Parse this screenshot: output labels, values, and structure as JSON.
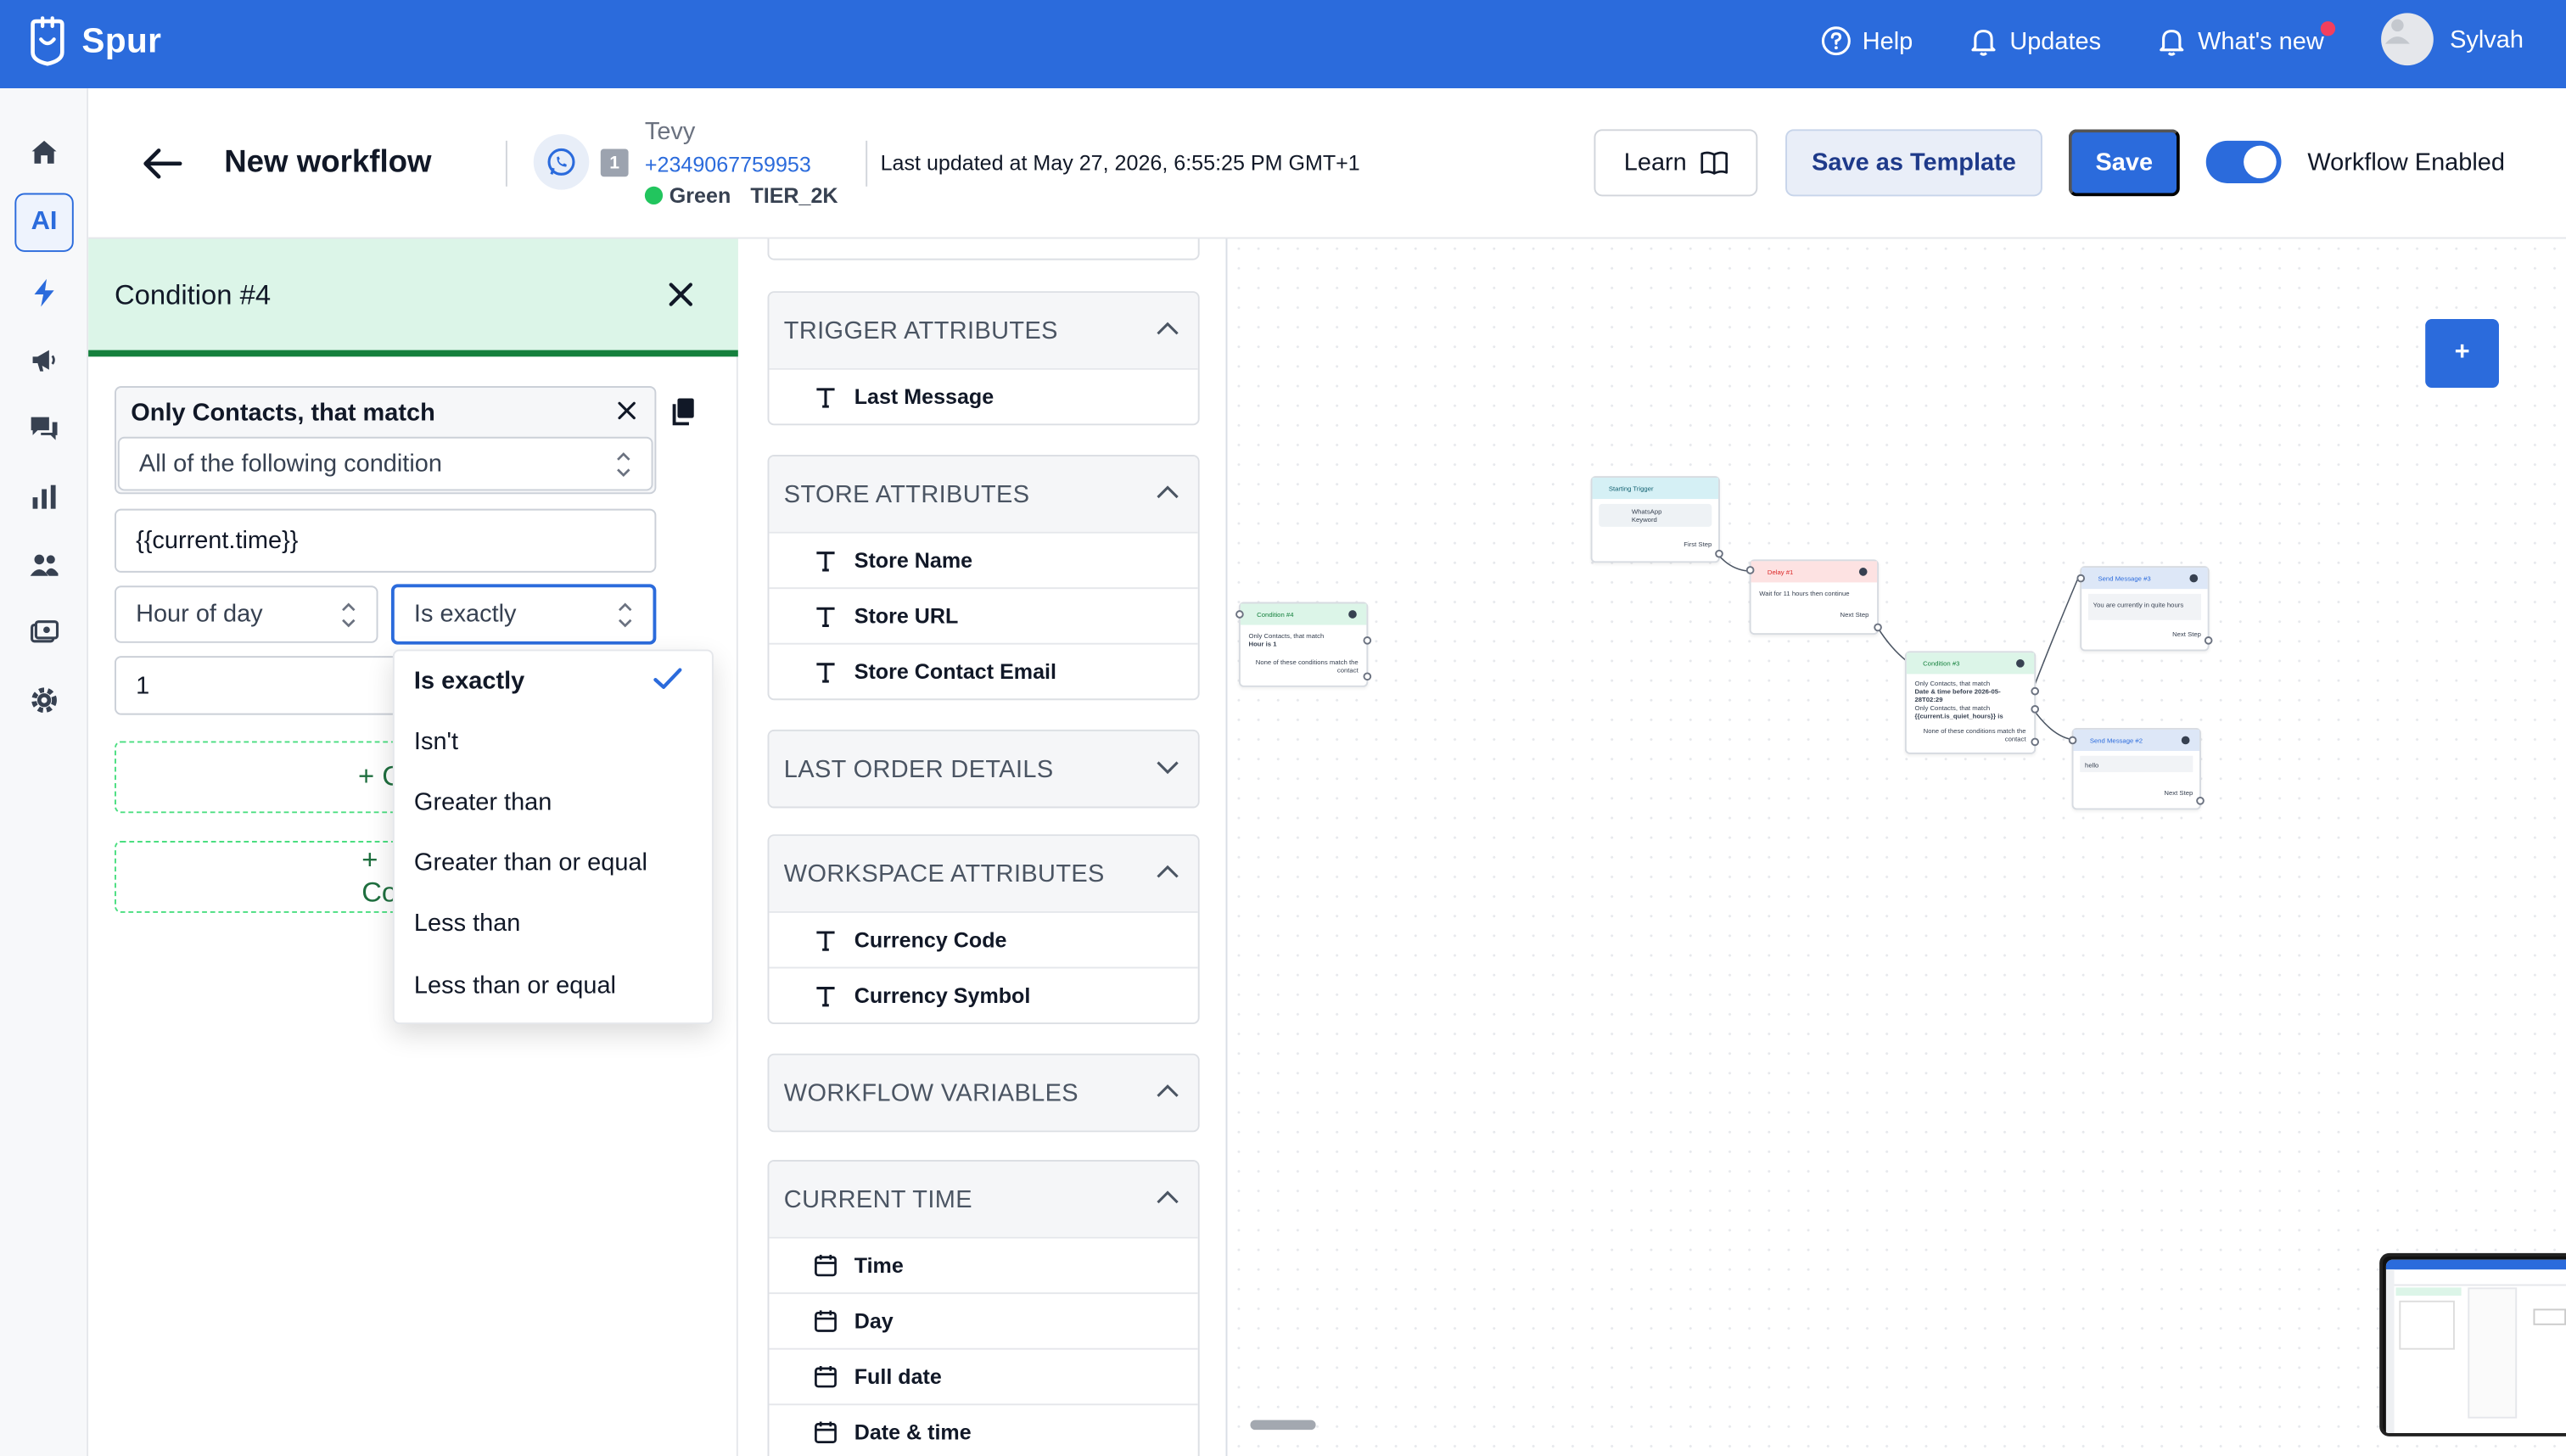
{
  "app": {
    "brand": "Spur"
  },
  "topbar": {
    "help": "Help",
    "updates": "Updates",
    "whats_new": "What's new",
    "user": "Sylvah"
  },
  "nav": {
    "ai_label": "AI"
  },
  "header": {
    "title": "New workflow",
    "account_number": "1",
    "account_name": "Tevy",
    "account_phone": "+2349067759953",
    "account_quality": "Green",
    "account_tier": "TIER_2K",
    "last_updated": "Last updated at May 27, 2026, 6:55:25 PM GMT+1",
    "learn": "Learn",
    "save_template": "Save as Template",
    "save": "Save",
    "workflow_enabled": "Workflow Enabled"
  },
  "condition": {
    "title": "Condition #4",
    "match_label": "Only Contacts, that match",
    "match_mode": "All of the following condition",
    "variable": "{{current.time}}",
    "field": "Hour of day",
    "operator": "Is exactly",
    "value": "1",
    "add_condition_1": "+ Co",
    "add_condition_2": "+ Condi",
    "operator_options": [
      "Is exactly",
      "Isn't",
      "Greater than",
      "Greater than or equal",
      "Less than",
      "Less than or equal"
    ]
  },
  "attributes": {
    "groups": [
      {
        "title": "TRIGGER ATTRIBUTES",
        "expanded": true,
        "items": [
          {
            "label": "Last Message",
            "icon": "text-icon"
          }
        ]
      },
      {
        "title": "STORE ATTRIBUTES",
        "expanded": true,
        "items": [
          {
            "label": "Store Name",
            "icon": "text-icon"
          },
          {
            "label": "Store URL",
            "icon": "text-icon"
          },
          {
            "label": "Store Contact Email",
            "icon": "text-icon"
          }
        ]
      },
      {
        "title": "LAST ORDER DETAILS",
        "expanded": false,
        "items": []
      },
      {
        "title": "WORKSPACE ATTRIBUTES",
        "expanded": true,
        "items": [
          {
            "label": "Currency Code",
            "icon": "text-icon"
          },
          {
            "label": "Currency Symbol",
            "icon": "text-icon"
          }
        ]
      },
      {
        "title": "WORKFLOW VARIABLES",
        "expanded": true,
        "items": []
      },
      {
        "title": "CURRENT TIME",
        "expanded": true,
        "items": [
          {
            "label": "Time",
            "icon": "calendar-icon"
          },
          {
            "label": "Day",
            "icon": "calendar-icon"
          },
          {
            "label": "Full date",
            "icon": "calendar-icon"
          },
          {
            "label": "Date & time",
            "icon": "calendar-icon"
          }
        ]
      }
    ]
  },
  "canvas": {
    "add_label": "+",
    "nodes": {
      "condition4": {
        "title": "Condition #4",
        "l1": "Only Contacts, that match",
        "l2": "Hour is 1",
        "footer": "None of these conditions match the contact"
      },
      "starting": {
        "title": "Starting Trigger",
        "l1": "WhatsApp",
        "l2": "Keyword",
        "footer": "First Step"
      },
      "delay": {
        "title": "Delay #1",
        "l1": "Wait for 11 hours then continue",
        "footer": "Next Step"
      },
      "condition3": {
        "title": "Condition #3",
        "l1": "Only Contacts, that match",
        "l2": "Date & time before 2026-05-28T02:29",
        "l3": "Only Contacts, that match",
        "l4": "{{current.is_quiet_hours}} is",
        "footer": "None of these conditions match the contact"
      },
      "send3": {
        "title": "Send Message #3",
        "l1": "You are currently in quite hours",
        "footer": "Next Step"
      },
      "send2": {
        "title": "Send Message #2",
        "l1": "hello",
        "footer": "Next Step"
      }
    }
  },
  "colors": {
    "brand_blue": "#2b6bdc",
    "condition_green": "#15803d",
    "condition_bg": "#dcf5e8"
  }
}
